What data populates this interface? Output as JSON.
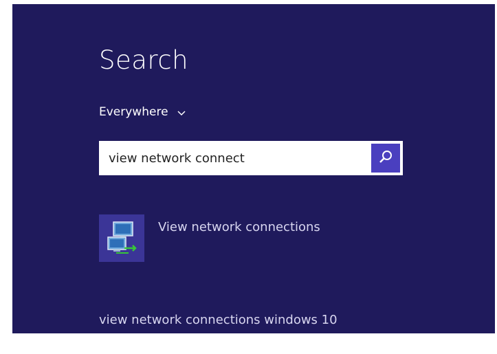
{
  "search_panel": {
    "title": "Search",
    "scope": {
      "selected": "Everywhere"
    },
    "search_box": {
      "value": "view network connect"
    },
    "results": [
      {
        "label": "View network connections",
        "icon": "network-connections-icon"
      }
    ],
    "suggestions": [
      {
        "label": "view network connections windows 10"
      }
    ]
  },
  "colors": {
    "background": "#1f1a5c",
    "accent": "#4a3fbf",
    "tile": "#3b3597"
  }
}
